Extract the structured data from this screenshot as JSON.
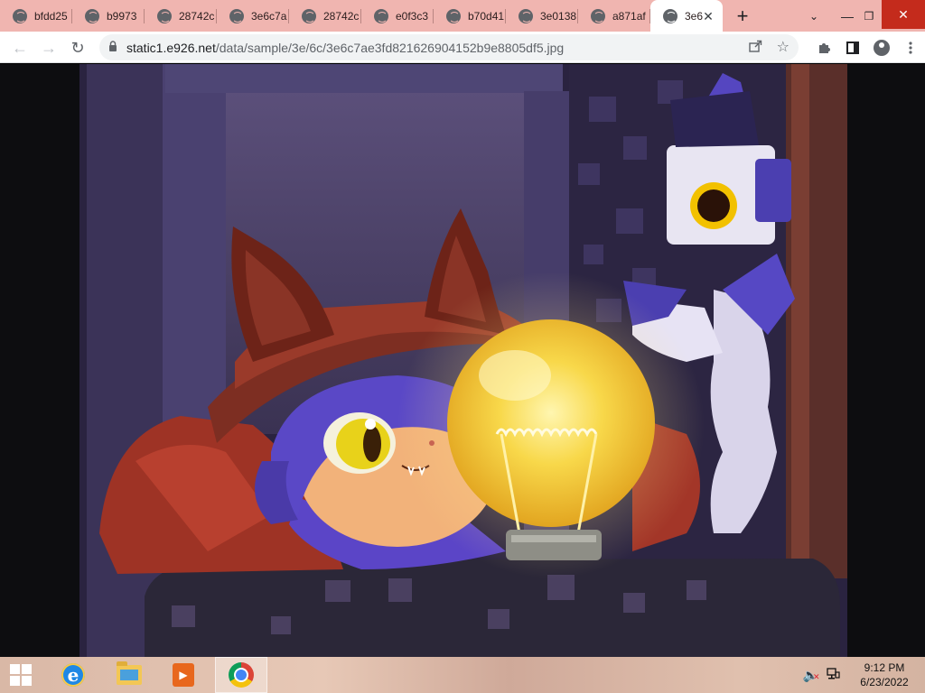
{
  "browser": {
    "tabs": [
      {
        "label": "bfdd25",
        "active": false
      },
      {
        "label": "b9973",
        "active": false
      },
      {
        "label": "28742c",
        "active": false
      },
      {
        "label": "3e6c7a",
        "active": false
      },
      {
        "label": "28742c",
        "active": false
      },
      {
        "label": "e0f3c3",
        "active": false
      },
      {
        "label": "b70d41",
        "active": false
      },
      {
        "label": "3e0138",
        "active": false
      },
      {
        "label": "a871af",
        "active": false
      },
      {
        "label": "3e6",
        "active": true
      }
    ],
    "close_tab_glyph": "✕",
    "new_tab_glyph": "+",
    "tab_search_glyph": "⌄",
    "minimize_glyph": "—",
    "maximize_glyph": "❐",
    "close_window_glyph": "✕",
    "back_glyph": "←",
    "forward_glyph": "→",
    "reload_glyph": "↻",
    "url_host": "static1.e926.net",
    "url_path": "/data/sample/3e/6c/3e6c7ae3fd821626904152b9e8805df5.jpg",
    "icons": {
      "lock": "lock-icon",
      "share": "share-icon",
      "bookmark": "star-icon",
      "extensions": "puzzle-icon",
      "side_panel": "side-panel-icon",
      "profile": "profile-icon",
      "menu": "kebab-menu-icon"
    },
    "accent_color": "#f0b5b0"
  },
  "taskbar": {
    "pinned": [
      "start-button",
      "internet-explorer-icon",
      "file-explorer-icon",
      "media-player-icon",
      "chrome-icon"
    ],
    "active_app": "chrome-icon",
    "tray": {
      "volume_muted": true,
      "time": "9:12 PM",
      "date": "6/23/2022"
    }
  }
}
